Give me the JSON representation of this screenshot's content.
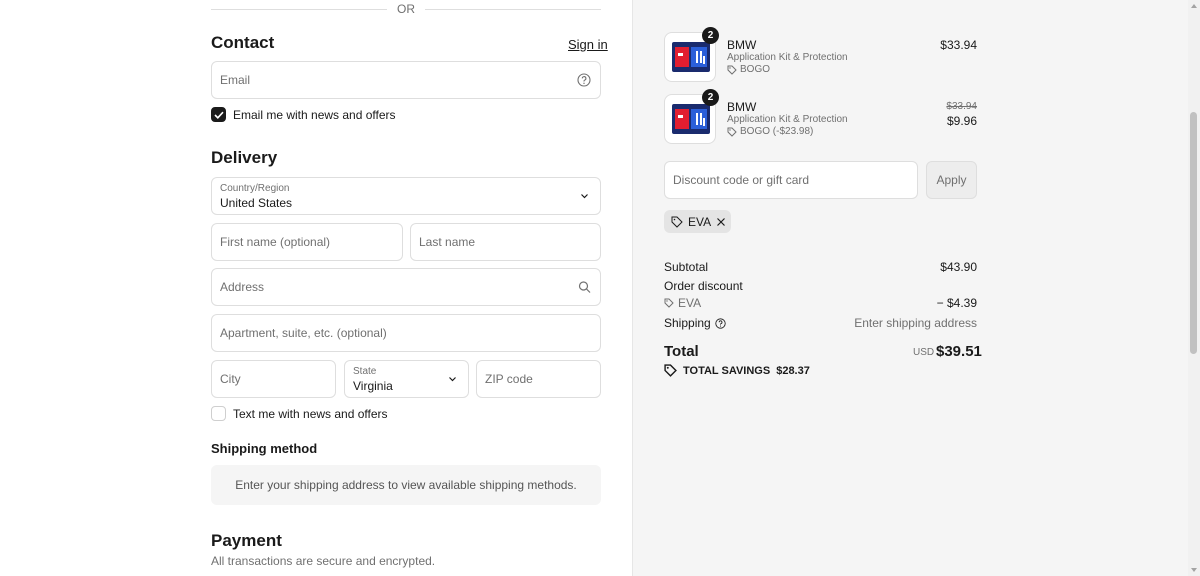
{
  "divider": {
    "text": "OR"
  },
  "contact": {
    "heading": "Contact",
    "sign_in": "Sign in",
    "email_placeholder": "Email",
    "news_label": "Email me with news and offers",
    "news_checked": true
  },
  "delivery": {
    "heading": "Delivery",
    "country_label": "Country/Region",
    "country_value": "United States",
    "first_name_placeholder": "First name (optional)",
    "last_name_placeholder": "Last name",
    "address_placeholder": "Address",
    "apartment_placeholder": "Apartment, suite, etc. (optional)",
    "city_placeholder": "City",
    "state_label": "State",
    "state_value": "Virginia",
    "zip_placeholder": "ZIP code",
    "text_label": "Text me with news and offers",
    "text_checked": false
  },
  "shipping": {
    "heading": "Shipping method",
    "message": "Enter your shipping address to view available shipping methods."
  },
  "payment": {
    "heading": "Payment",
    "subtitle": "All transactions are secure and encrypted."
  },
  "cart": {
    "items": [
      {
        "qty": "2",
        "name": "BMW",
        "desc": "Application Kit & Protection",
        "tag": "BOGO",
        "price": "$33.94"
      },
      {
        "qty": "2",
        "name": "BMW",
        "desc": "Application Kit & Protection",
        "tag": "BOGO (-$23.98)",
        "original_price": "$33.94",
        "price": "$9.96"
      }
    ],
    "discount_placeholder": "Discount code or gift card",
    "apply_label": "Apply",
    "applied_code": "EVA"
  },
  "summary": {
    "subtotal_label": "Subtotal",
    "subtotal_value": "$43.90",
    "order_discount_label": "Order discount",
    "discount_code": "EVA",
    "discount_value": "− $4.39",
    "shipping_label": "Shipping",
    "shipping_value": "Enter shipping address",
    "total_label": "Total",
    "currency": "USD",
    "total_value": "$39.51",
    "savings_label": "TOTAL SAVINGS",
    "savings_value": "$28.37"
  },
  "colors": {
    "accent": "#1a1a1a",
    "panel_bg": "#f5f5f5",
    "muted_text": "#707070"
  }
}
